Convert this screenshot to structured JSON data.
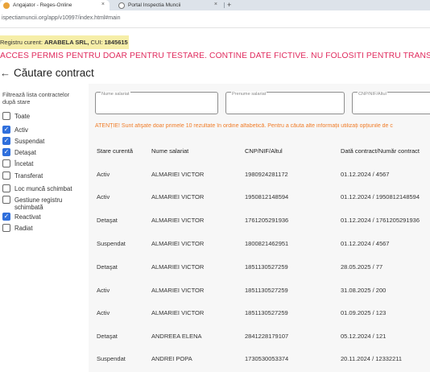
{
  "browser": {
    "tabs": [
      {
        "label": "Angajator - Reges-Online",
        "active": true
      },
      {
        "label": "Portal Inspectia Muncii",
        "active": false
      }
    ],
    "close_glyph": "×",
    "new_tab_glyph": "+",
    "url": "ispectiamuncii.org/app/v10997/index.html#main"
  },
  "registry": {
    "prefix": "Registru curent:",
    "company": "ARABELA SRL,",
    "cui_label": "CUI:",
    "cui": "1845615"
  },
  "warning_banner": "ACCES PERMIS PENTRU DOAR PENTRU TESTARE. CONTINE DATE FICTIVE. NU FOLOSITI PENTRU TRANSMITEREA",
  "header": {
    "back_glyph": "←",
    "title": "Căutare contract"
  },
  "sidebar": {
    "title": "Filtrează lista contractelor după stare",
    "check_glyph": "✓",
    "filters": [
      {
        "label": "Toate",
        "checked": false
      },
      {
        "label": "Activ",
        "checked": true
      },
      {
        "label": "Suspendat",
        "checked": true
      },
      {
        "label": "Detaşat",
        "checked": true
      },
      {
        "label": "Încetat",
        "checked": false
      },
      {
        "label": "Transferat",
        "checked": false
      },
      {
        "label": "Loc muncă schimbat",
        "checked": false
      },
      {
        "label": "Gestiune registru schimbată",
        "checked": false
      },
      {
        "label": "Reactivat",
        "checked": true
      },
      {
        "label": "Radiat",
        "checked": false
      }
    ]
  },
  "search": {
    "fields": [
      {
        "placeholder": "Nume salariat"
      },
      {
        "placeholder": "Prenume salariat"
      },
      {
        "placeholder": "CNP/NIF/Altul"
      }
    ]
  },
  "notice": "ATENȚIE! Sunt afişate doar primele 10 rezultate în ordine alfabetică. Pentru a căuta alte informații utilizați opțiunile de c",
  "table": {
    "headers": [
      "Stare curentă",
      "Nume salariat",
      "CNP/NIF/Altul",
      "Dată contract/Număr contract"
    ],
    "rows": [
      {
        "stare": "Activ",
        "nume": "ALMARIEI VICTOR",
        "cnp": "1980924281172",
        "contract": "01.12.2024 / 4567"
      },
      {
        "stare": "Activ",
        "nume": "ALMARIEI VICTOR",
        "cnp": "1950812148594",
        "contract": "01.12.2024 / 1950812148594"
      },
      {
        "stare": "Detaşat",
        "nume": "ALMARIEI VICTOR",
        "cnp": "1761205291936",
        "contract": "01.12.2024 / 1761205291936"
      },
      {
        "stare": "Suspendat",
        "nume": "ALMARIEI VICTOR",
        "cnp": "1800821462951",
        "contract": "01.12.2024 / 4567"
      },
      {
        "stare": "Detaşat",
        "nume": "ALMARIEI VICTOR",
        "cnp": "1851130527259",
        "contract": "28.05.2025 / 77"
      },
      {
        "stare": "Activ",
        "nume": "ALMARIEI VICTOR",
        "cnp": "1851130527259",
        "contract": "31.08.2025 / 200"
      },
      {
        "stare": "Activ",
        "nume": "ALMARIEI VICTOR",
        "cnp": "1851130527259",
        "contract": "01.09.2025 / 123"
      },
      {
        "stare": "Detaşat",
        "nume": "ANDREEA ELENA",
        "cnp": "2841228179107",
        "contract": "05.12.2024 / 121"
      },
      {
        "stare": "Suspendat",
        "nume": "ANDREI POPA",
        "cnp": "1730530053374",
        "contract": "20.11.2024 / 12332211"
      }
    ]
  },
  "colors": {
    "warning": "#e02b5e",
    "notice": "#f07c28",
    "checkbox": "#2f6fdc",
    "registry_bg": "#f6eea8"
  }
}
